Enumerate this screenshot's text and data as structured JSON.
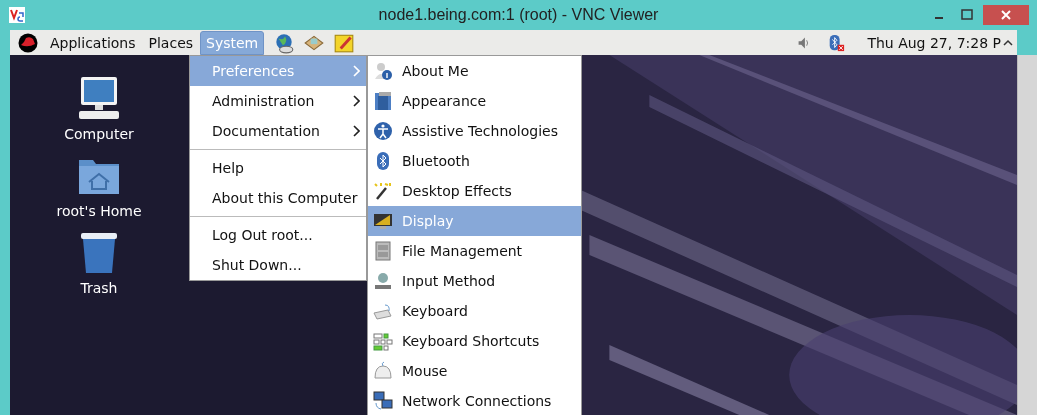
{
  "window": {
    "title": "node1.being.com:1 (root) - VNC Viewer"
  },
  "panel": {
    "menus": [
      {
        "label": "Applications",
        "selected": false
      },
      {
        "label": "Places",
        "selected": false
      },
      {
        "label": "System",
        "selected": true
      }
    ],
    "clock": "Thu Aug 27,  7:28 P"
  },
  "desktop": {
    "icons": [
      {
        "label": "Computer"
      },
      {
        "label": "root's Home"
      },
      {
        "label": "Trash"
      }
    ]
  },
  "system_menu": {
    "items": [
      {
        "kind": "item",
        "label": "Preferences",
        "submenu": true,
        "selected": true
      },
      {
        "kind": "item",
        "label": "Administration",
        "submenu": true,
        "selected": false
      },
      {
        "kind": "item",
        "label": "Documentation",
        "submenu": true,
        "selected": false
      },
      {
        "kind": "separator"
      },
      {
        "kind": "item",
        "label": "Help",
        "submenu": false,
        "selected": false
      },
      {
        "kind": "item",
        "label": "About this Computer",
        "submenu": false,
        "selected": false
      },
      {
        "kind": "separator"
      },
      {
        "kind": "item",
        "label": "Log Out root...",
        "submenu": false,
        "selected": false
      },
      {
        "kind": "item",
        "label": "Shut Down...",
        "submenu": false,
        "selected": false
      }
    ]
  },
  "preferences_menu": {
    "items": [
      {
        "label": "About Me",
        "selected": false
      },
      {
        "label": "Appearance",
        "selected": false
      },
      {
        "label": "Assistive Technologies",
        "selected": false
      },
      {
        "label": "Bluetooth",
        "selected": false
      },
      {
        "label": "Desktop Effects",
        "selected": false
      },
      {
        "label": "Display",
        "selected": true
      },
      {
        "label": "File Management",
        "selected": false
      },
      {
        "label": "Input Method",
        "selected": false
      },
      {
        "label": "Keyboard",
        "selected": false
      },
      {
        "label": "Keyboard Shortcuts",
        "selected": false
      },
      {
        "label": "Mouse",
        "selected": false
      },
      {
        "label": "Network Connections",
        "selected": false
      }
    ]
  }
}
